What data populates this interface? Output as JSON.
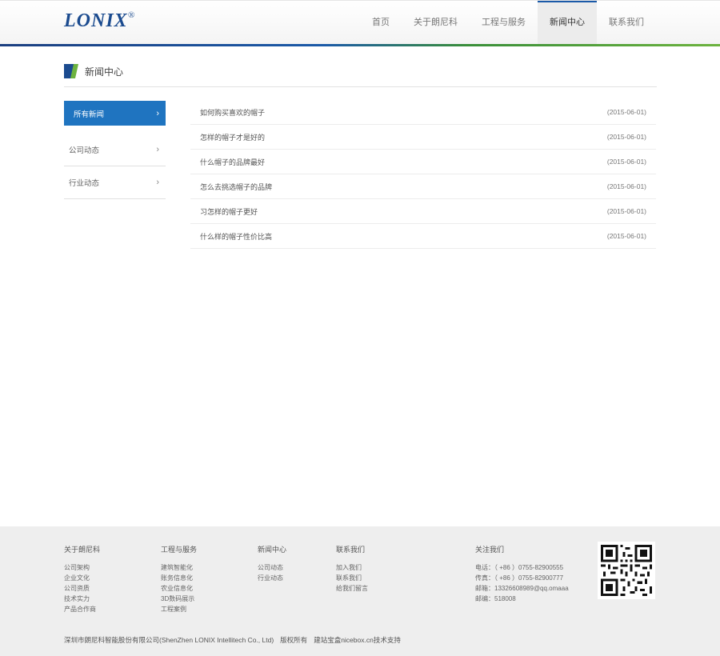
{
  "header": {
    "logo_text": "LONIX",
    "logo_reg": "®",
    "nav": [
      {
        "label": "首页"
      },
      {
        "label": "关于朗尼科"
      },
      {
        "label": "工程与服务"
      },
      {
        "label": "新闻中心"
      },
      {
        "label": "联系我们"
      }
    ]
  },
  "section": {
    "title": "新闻中心"
  },
  "sidebar": {
    "items": [
      {
        "label": "所有新闻"
      },
      {
        "label": "公司动态"
      },
      {
        "label": "行业动态"
      }
    ],
    "chevron": "›"
  },
  "news": [
    {
      "title": "如何购买喜欢的帽子",
      "date": "(2015-06-01)"
    },
    {
      "title": "怎样的帽子才是好的",
      "date": "(2015-06-01)"
    },
    {
      "title": "什么帽子的品牌最好",
      "date": "(2015-06-01)"
    },
    {
      "title": "怎么去挑选帽子的品牌",
      "date": "(2015-06-01)"
    },
    {
      "title": "习怎样的帽子更好",
      "date": "(2015-06-01)"
    },
    {
      "title": "什么样的帽子性价比高",
      "date": "(2015-06-01)"
    }
  ],
  "footer": {
    "columns": [
      {
        "title": "关于朗尼科",
        "links": [
          "公司架构",
          "企业文化",
          "公司资质",
          "技术实力",
          "产品合作商"
        ]
      },
      {
        "title": "工程与服务",
        "links": [
          "建筑智能化",
          "账务信息化",
          "农业信息化",
          "3D数码展示",
          "工程案例"
        ]
      },
      {
        "title": "新闻中心",
        "links": [
          "公司动态",
          "行业动态"
        ]
      },
      {
        "title": "联系我们",
        "links": [
          "加入我们",
          "联系我们",
          "给我们留言"
        ]
      },
      {
        "title": "关注我们",
        "links": [
          "电话：（ +86 ）0755-82900555",
          "传真：（ +86 ）0755-82900777",
          "邮箱：13326608989@qq.omaaa",
          "邮编：518008"
        ]
      }
    ],
    "copyright": "深圳市朗尼科智能股份有限公司(ShenZhen LONIX Intellitech Co., Ltd)",
    "rights": "版权所有",
    "support": "建站宝盒nicebox.cn技术支持"
  }
}
